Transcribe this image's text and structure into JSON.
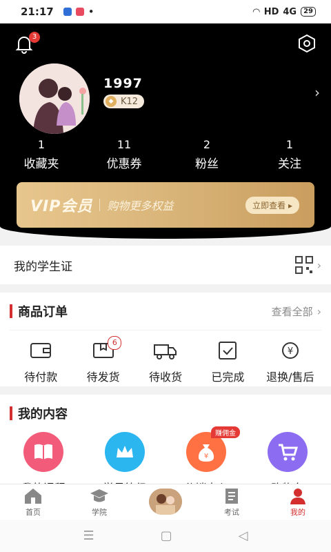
{
  "status_bar": {
    "time": "21:17",
    "network": "HD",
    "signal": "4G",
    "battery": "29"
  },
  "header": {
    "bell_badge": "3",
    "username": "1997",
    "level": "K12",
    "stats": [
      {
        "value": "1",
        "label": "收藏夹"
      },
      {
        "value": "11",
        "label": "优惠券"
      },
      {
        "value": "2",
        "label": "粉丝"
      },
      {
        "value": "1",
        "label": "关注"
      }
    ],
    "vip": {
      "title": "VIP会员",
      "desc": "购物更多权益",
      "button": "立即查看 ▸"
    }
  },
  "student_card": {
    "title": "我的学生证"
  },
  "orders": {
    "title": "商品订单",
    "more": "查看全部",
    "items": [
      {
        "label": "待付款",
        "icon": "wallet-icon"
      },
      {
        "label": "待发货",
        "icon": "package-icon",
        "badge": "6"
      },
      {
        "label": "待收货",
        "icon": "truck-icon"
      },
      {
        "label": "已完成",
        "icon": "check-box-icon"
      },
      {
        "label": "退换/售后",
        "icon": "refund-icon"
      }
    ]
  },
  "content": {
    "title": "我的内容",
    "earn_tag": "赚佣金",
    "items": [
      {
        "label": "我的课程",
        "icon": "book-icon",
        "color": "#f25c7a"
      },
      {
        "label": "学员等级",
        "icon": "crown-icon",
        "color": "#2bb6f0"
      },
      {
        "label": "分销中心",
        "icon": "money-bag-icon",
        "color": "#ff7043"
      },
      {
        "label": "购物车",
        "icon": "cart-icon",
        "color": "#8c6cf0"
      }
    ]
  },
  "bottom_nav": [
    {
      "label": "首页",
      "icon": "home-icon"
    },
    {
      "label": "学院",
      "icon": "graduation-cap-icon"
    },
    {
      "label": "",
      "icon": "center-avatar"
    },
    {
      "label": "考试",
      "icon": "exam-icon"
    },
    {
      "label": "我的",
      "icon": "profile-icon",
      "active": true
    }
  ],
  "colors": {
    "accent": "#d32f2f",
    "header_bg": "#000000",
    "vip_gold": "#d9b57a"
  }
}
